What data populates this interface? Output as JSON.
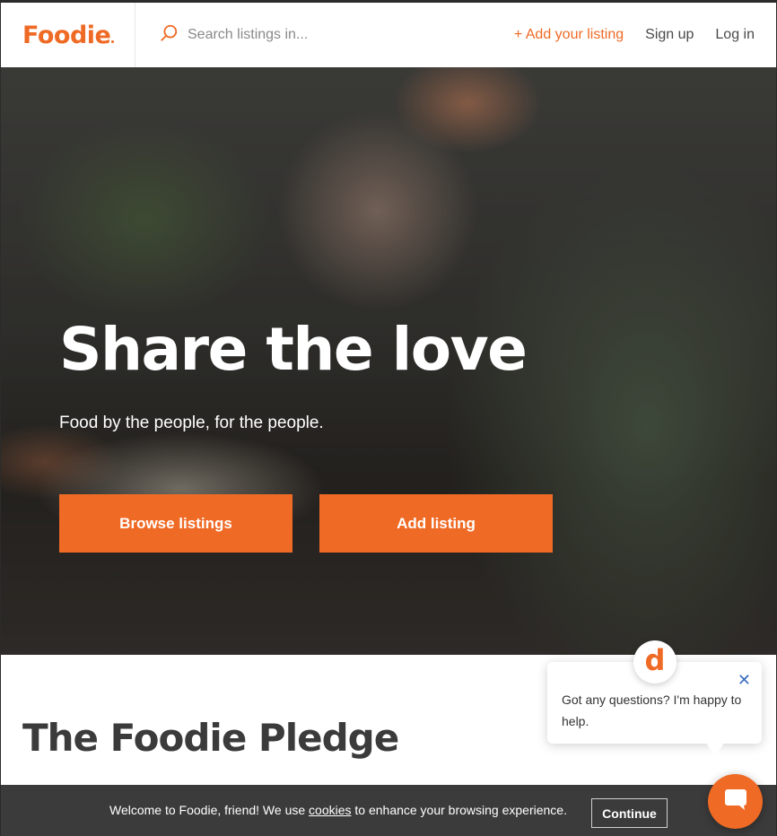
{
  "header": {
    "logo_text": "Foodie",
    "search_placeholder": "Search listings in...",
    "search_icon": "search-icon",
    "nav": {
      "add_listing": "+ Add your listing",
      "sign_up": "Sign up",
      "log_in": "Log in"
    }
  },
  "hero": {
    "title": "Share the love",
    "subtitle": "Food by the people, for the people.",
    "browse_button": "Browse listings",
    "add_button": "Add listing"
  },
  "pledge": {
    "title": "The Foodie Pledge"
  },
  "chat": {
    "avatar_letter": "d",
    "message": "Got any questions? I'm happy to help.",
    "close_icon": "close-icon",
    "launcher_icon": "chat-bubble-icon"
  },
  "cookie_banner": {
    "text_before": "Welcome to Foodie, friend! We use ",
    "link": "cookies",
    "text_after": " to enhance your browsing experience.",
    "continue": "Continue"
  },
  "colors": {
    "brand": "#ef6a25",
    "banner_bg": "#3b3b3b",
    "text_dark": "#3b3b3b"
  }
}
